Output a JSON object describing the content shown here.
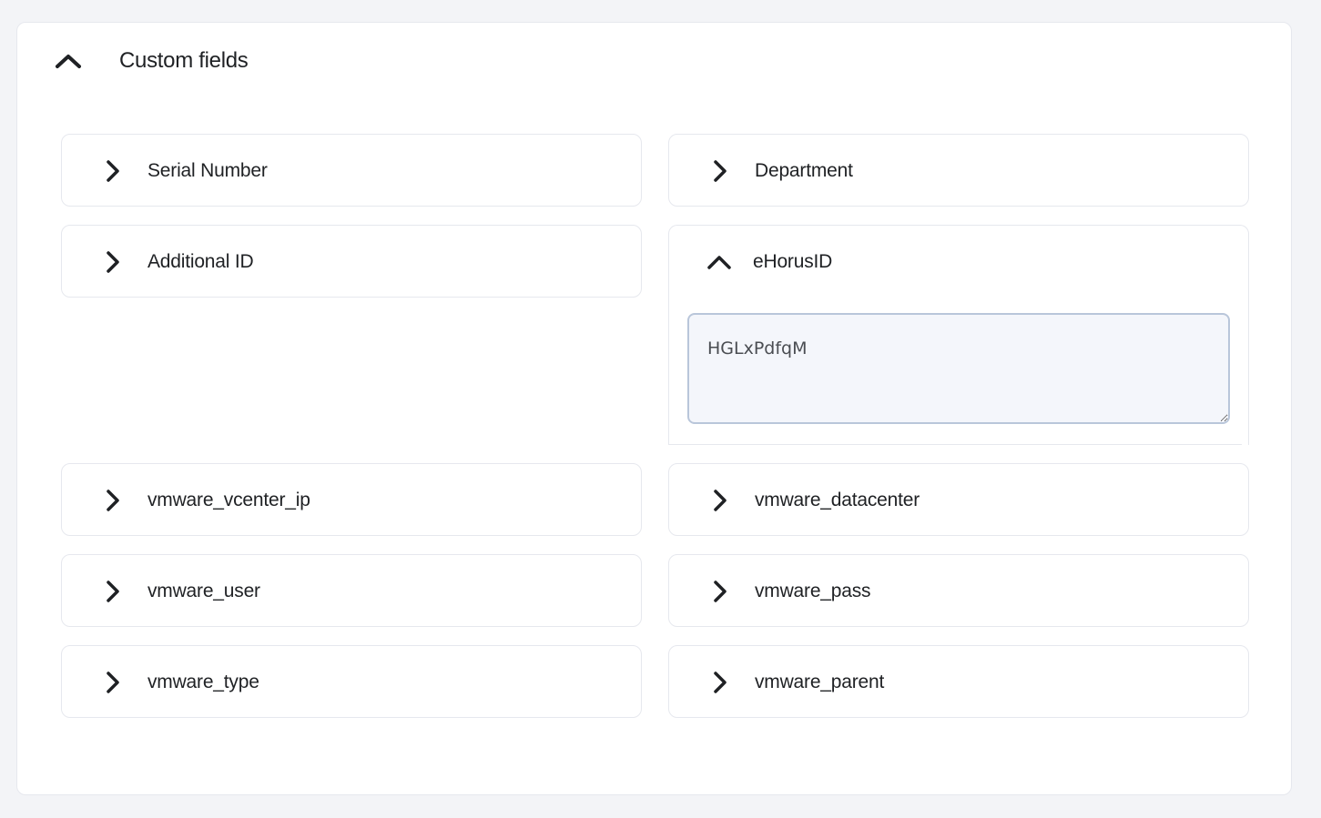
{
  "section": {
    "title": "Custom fields",
    "expanded": true
  },
  "fields": {
    "serial_number": "Serial Number",
    "department": "Department",
    "additional_id": "Additional ID",
    "ehorusid": "eHorusID",
    "vmware_vcenter_ip": "vmware_vcenter_ip",
    "vmware_datacenter": "vmware_datacenter",
    "vmware_user": "vmware_user",
    "vmware_pass": "vmware_pass",
    "vmware_type": "vmware_type",
    "vmware_parent": "vmware_parent"
  },
  "ehorusid_value": "HGLxPdfqM",
  "icons": {
    "collapsed": "chevron-right-icon",
    "expanded": "chevron-up-icon"
  }
}
